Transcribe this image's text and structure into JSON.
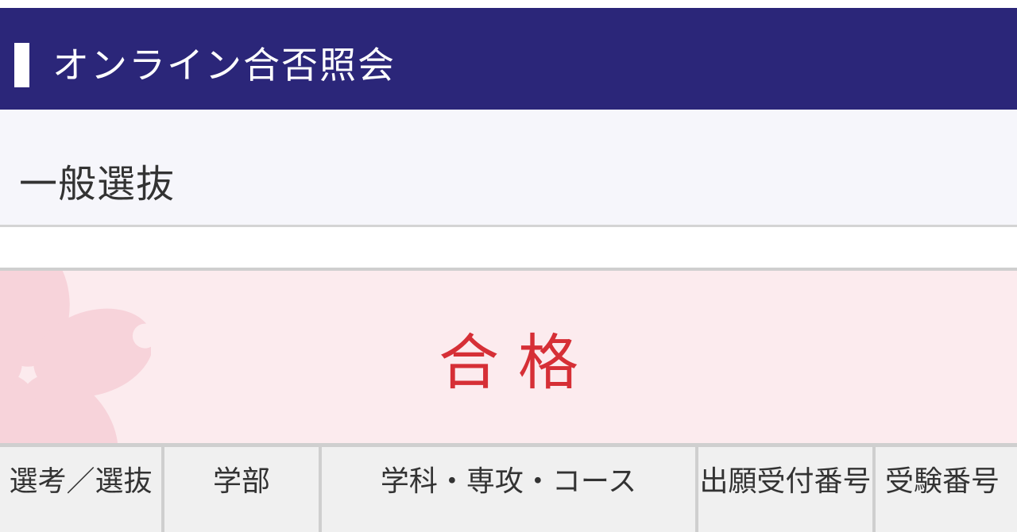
{
  "header": {
    "title": "オンライン合否照会"
  },
  "section": {
    "title": "一般選抜"
  },
  "result": {
    "text": "合格"
  },
  "table": {
    "headers": [
      "選考／選抜",
      "学部",
      "学科・専攻・コース",
      "出願受付番号",
      "受験番号"
    ]
  },
  "colors": {
    "header_bg": "#2b2679",
    "result_bg": "#fcebee",
    "result_text": "#d62f36",
    "sakura_petal": "#f6cbd4"
  },
  "icons": [
    "sakura-flower-icon"
  ]
}
